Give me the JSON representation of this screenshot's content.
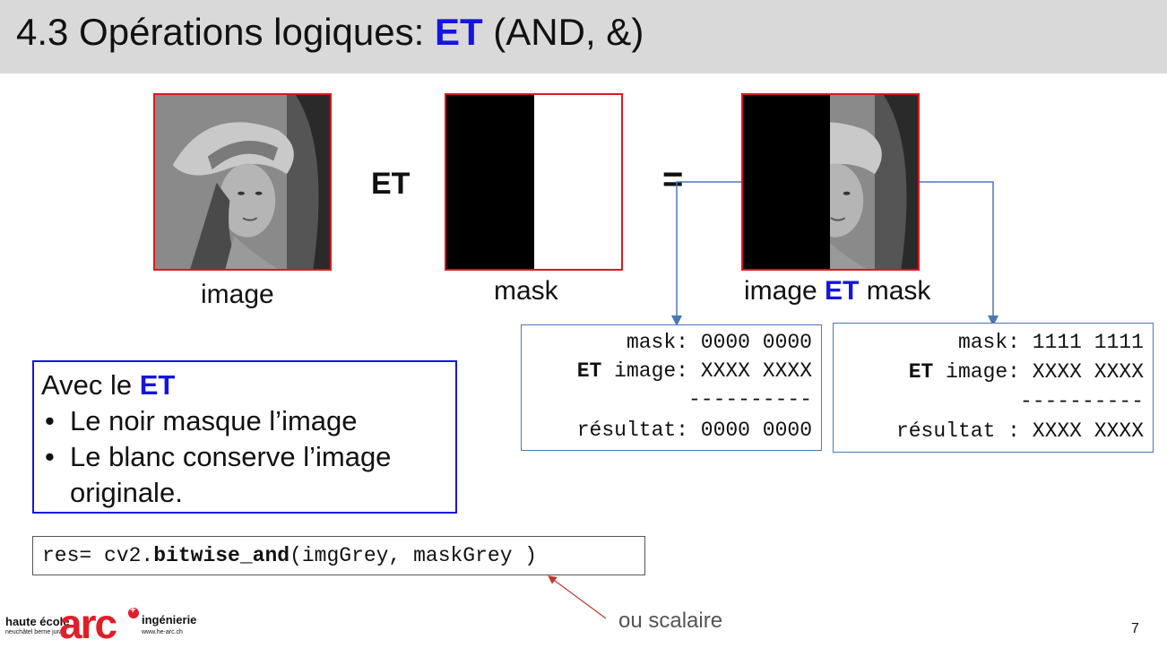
{
  "slide": {
    "title_prefix": "4.3 Opérations logiques: ",
    "title_accent": "ET",
    "title_suffix": " (AND, &)",
    "page_number": "7"
  },
  "operators": {
    "et": "ET",
    "equals": "="
  },
  "captions": {
    "image": "image",
    "mask": "mask",
    "result_prefix": "image ",
    "result_accent": "ET",
    "result_suffix": " mask"
  },
  "truth_boxes": [
    {
      "mask_line": "mask: 0000 0000",
      "et_keyword": "ET",
      "image_line": " image: XXXX XXXX",
      "separator": "----------",
      "result_line": "résultat: 0000 0000"
    },
    {
      "mask_line": "mask: 1111 1111",
      "et_keyword": "ET",
      "image_line": " image: XXXX XXXX",
      "separator": "----------",
      "result_line": "résultat : XXXX XXXX"
    }
  ],
  "info": {
    "heading_prefix": "Avec le ",
    "heading_accent": "ET",
    "bullets": [
      "Le noir masque l’image",
      "Le blanc conserve l’image",
      "originale."
    ],
    "bullet_marker": "•"
  },
  "code": {
    "prefix": "res= cv2.",
    "function": "bitwise_and",
    "suffix": "(imgGrey, maskGrey )"
  },
  "annotation": "ou scalaire",
  "logo": {
    "left_text": "haute école",
    "left_subtext": "neuchâtel berne jura",
    "brand": "arc",
    "right_text": "ingénierie",
    "url": "www.he-arc.ch"
  },
  "colors": {
    "accent_blue": "#1515e0",
    "frame_red": "#e0161d",
    "connector_blue": "#4a78b5",
    "title_bar": "#d9d9d9",
    "logo_red": "#e01f2a"
  }
}
